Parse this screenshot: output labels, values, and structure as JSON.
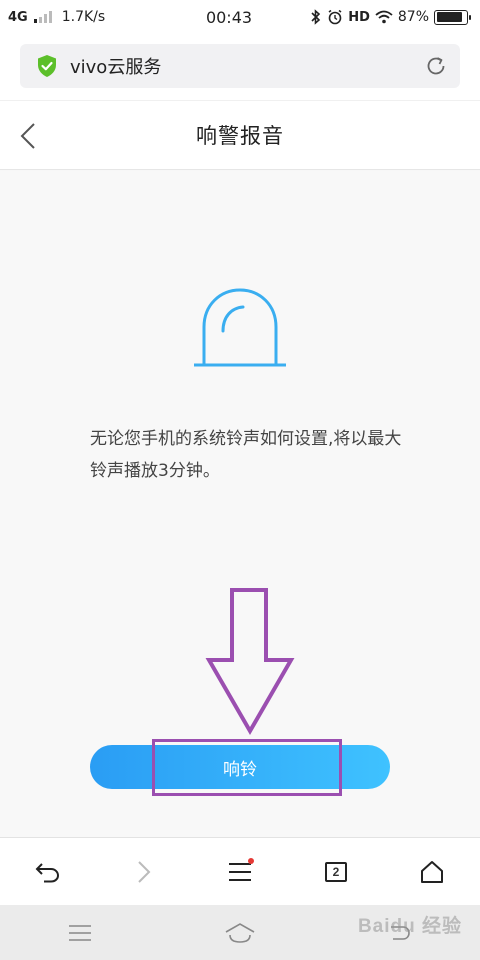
{
  "status_bar": {
    "network": "4G",
    "speed": "1.7K/s",
    "time": "00:43",
    "hd": "HD",
    "battery": "87%",
    "battery_level": 0.87
  },
  "address_bar": {
    "site_name": "vivo云服务"
  },
  "header": {
    "title": "响警报音"
  },
  "content": {
    "description": "无论您手机的系统铃声如何设置,将以最大铃声播放3分钟。",
    "ring_button": "响铃"
  },
  "toolbar": {
    "tabs_count": "2"
  },
  "watermark": "Baidu 经验",
  "colors": {
    "accent": "#2a9df4",
    "bell_stroke": "#3aaef0",
    "shield": "#5cbf2a",
    "highlight": "#9b4fb0",
    "notification_dot": "#e53935"
  },
  "icons": [
    "shield-icon",
    "reload-icon",
    "back-icon",
    "bell-icon",
    "back-arrow-icon",
    "forward-arrow-icon",
    "menu-icon",
    "tabs-icon",
    "home-icon",
    "nav-menu-icon",
    "nav-home-icon",
    "nav-back-icon"
  ]
}
